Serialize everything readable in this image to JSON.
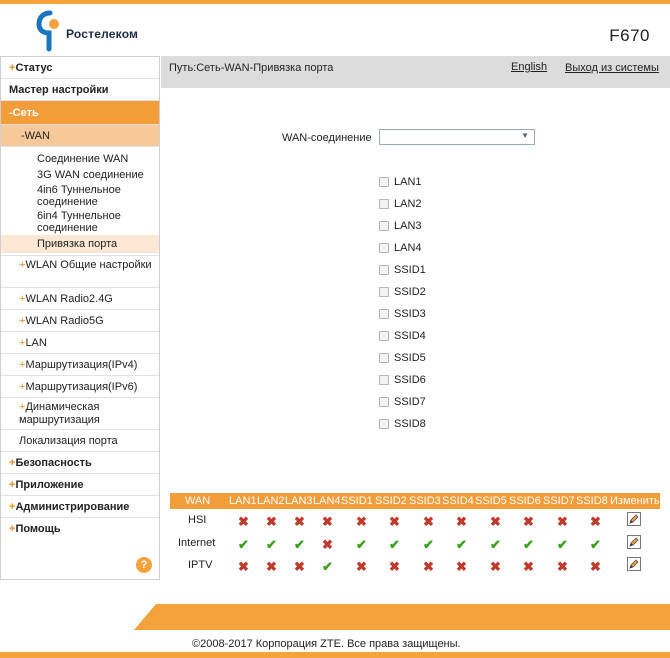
{
  "header": {
    "logo_text": "Ростелеком",
    "model": "F670"
  },
  "sidebar": {
    "status": "Статус",
    "wizard": "Мастер настройки",
    "network": "Сеть",
    "wan": "-WAN",
    "wan_subitems": [
      "Соединение WAN",
      "3G WAN соединение",
      "4in6 Туннельное соединение",
      "6in4 Туннельное соединение",
      "Привязка порта"
    ],
    "wlan_general": "WLAN Общие настройки",
    "wlan_radio24": "WLAN Radio2.4G",
    "wlan_radio5": "WLAN Radio5G",
    "lan": "LAN",
    "routing_ipv4": "Маршрутизация(IPv4)",
    "routing_ipv6": "Маршрутизация(IPv6)",
    "dynamic_routing": "Динамическая маршрутизация",
    "port_localization": "Локализация порта",
    "security": "Безопасность",
    "application": "Приложение",
    "administration": "Администрирование",
    "help": "Помощь",
    "help_icon": "?"
  },
  "pathbar": {
    "path": "Путь:Сеть-WAN-Привязка порта",
    "english": "English",
    "logout": "Выход из системы"
  },
  "form": {
    "wan_label": "WAN-соединение",
    "wan_value": "",
    "ports": [
      "LAN1",
      "LAN2",
      "LAN3",
      "LAN4",
      "SSID1",
      "SSID2",
      "SSID3",
      "SSID4",
      "SSID5",
      "SSID6",
      "SSID7",
      "SSID8"
    ]
  },
  "table": {
    "headers": [
      "WAN",
      "LAN1",
      "LAN2",
      "LAN3",
      "LAN4",
      "SSID1",
      "SSID2",
      "SSID3",
      "SSID4",
      "SSID5",
      "SSID6",
      "SSID7",
      "SSID8",
      "Изменить"
    ],
    "rows": [
      {
        "name": "HSI",
        "bindings": [
          false,
          false,
          false,
          false,
          false,
          false,
          false,
          false,
          false,
          false,
          false,
          false
        ]
      },
      {
        "name": "Internet",
        "bindings": [
          true,
          true,
          true,
          false,
          true,
          true,
          true,
          true,
          true,
          true,
          true,
          true
        ]
      },
      {
        "name": "IPTV",
        "bindings": [
          false,
          false,
          false,
          true,
          false,
          false,
          false,
          false,
          false,
          false,
          false,
          false
        ]
      }
    ]
  },
  "footer": {
    "copyright": "©2008-2017 Корпорация ZTE. Все права защищены."
  },
  "colors": {
    "accent": "#f39c3a",
    "yes": "#3aa11a",
    "no": "#c0392b"
  }
}
